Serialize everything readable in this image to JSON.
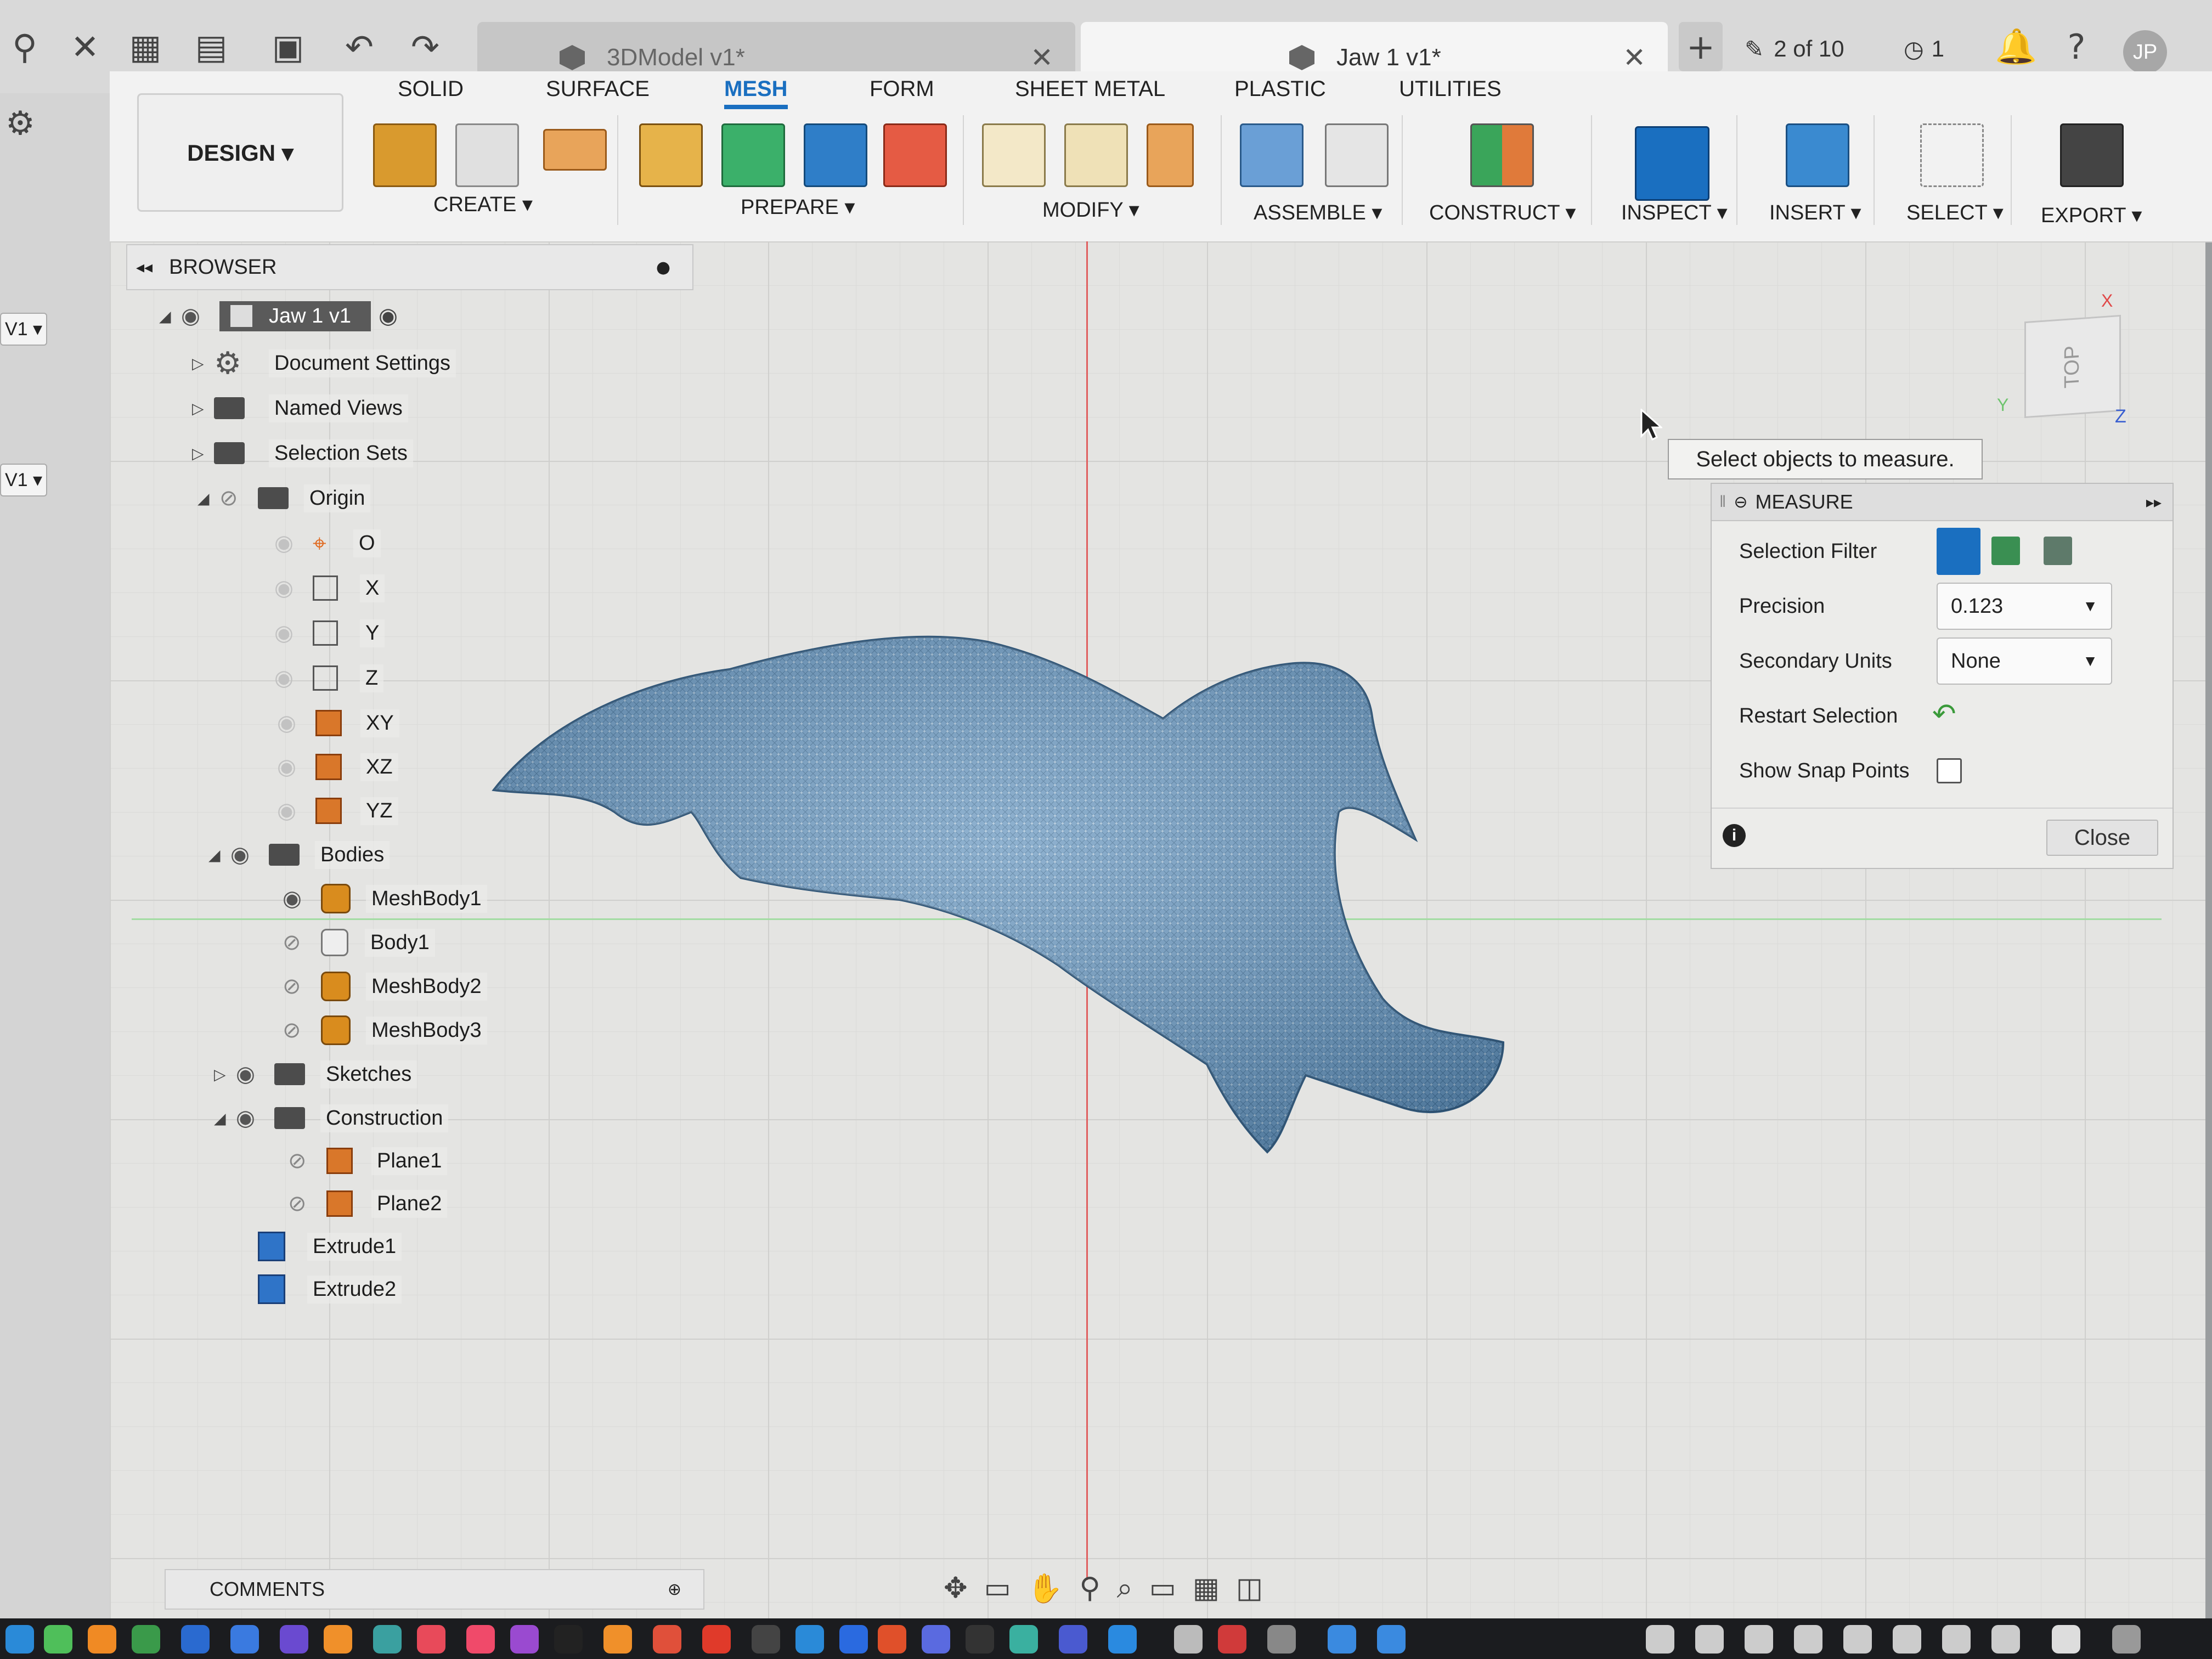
{
  "titlebar": {
    "tab_inactive": "3DModel v1*",
    "tab_active": "Jaw 1 v1*",
    "tab_close": "✕",
    "add_tab": "+",
    "jobs": "2 of 10",
    "clock_count": "1",
    "user_initials": "JP"
  },
  "left_strip": {
    "version_a": "V1 ▾",
    "version_b": "V1 ▾"
  },
  "ribbon": {
    "design_label": "DESIGN ▾",
    "tabs": [
      "SOLID",
      "SURFACE",
      "MESH",
      "FORM",
      "SHEET METAL",
      "PLASTIC",
      "UTILITIES"
    ],
    "active_tab": "MESH",
    "groups": [
      "CREATE ▾",
      "PREPARE ▾",
      "MODIFY ▾",
      "ASSEMBLE ▾",
      "CONSTRUCT ▾",
      "INSPECT ▾",
      "INSERT ▾",
      "SELECT ▾",
      "EXPORT ▾"
    ]
  },
  "browser": {
    "title": "BROWSER",
    "root": "Jaw 1 v1",
    "items": {
      "document_settings": "Document Settings",
      "named_views": "Named Views",
      "selection_sets": "Selection Sets",
      "origin": "Origin",
      "o": "O",
      "x": "X",
      "y": "Y",
      "z": "Z",
      "xy": "XY",
      "xz": "XZ",
      "yz": "YZ",
      "bodies": "Bodies",
      "meshbody1": "MeshBody1",
      "body1": "Body1",
      "meshbody2": "MeshBody2",
      "meshbody3": "MeshBody3",
      "sketches": "Sketches",
      "construction": "Construction",
      "plane1": "Plane1",
      "plane2": "Plane2",
      "extrude1": "Extrude1",
      "extrude2": "Extrude2"
    }
  },
  "viewcube": {
    "face": "TOP",
    "x": "X",
    "y": "Y",
    "z": "Z"
  },
  "measure": {
    "tooltip": "Select objects to measure.",
    "title": "MEASURE",
    "selection_filter_label": "Selection Filter",
    "precision_label": "Precision",
    "precision_value": "0.123",
    "secondary_units_label": "Secondary Units",
    "secondary_units_value": "None",
    "restart_label": "Restart Selection",
    "snap_label": "Show Snap Points",
    "close_label": "Close"
  },
  "comments": {
    "label": "COMMENTS"
  },
  "colors": {
    "accent": "#1a6fc0",
    "mesh": "#5f8fb8",
    "axis_red": "#e06060",
    "axis_green": "#a3dca3"
  }
}
